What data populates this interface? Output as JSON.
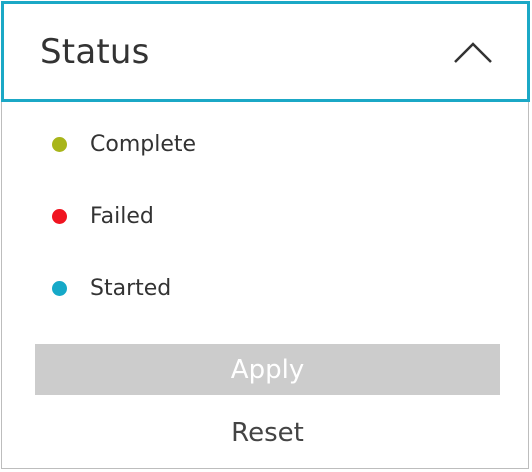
{
  "filter": {
    "title": "Status",
    "toggle_icon": "chevron-up-icon",
    "options": [
      {
        "label": "Complete",
        "color": "#a8b51a"
      },
      {
        "label": "Failed",
        "color": "#f01420"
      },
      {
        "label": "Started",
        "color": "#16a9c8"
      }
    ],
    "apply_label": "Apply",
    "reset_label": "Reset"
  },
  "colors": {
    "accent_border": "#1ba8c6",
    "apply_disabled_bg": "#cccccc"
  }
}
